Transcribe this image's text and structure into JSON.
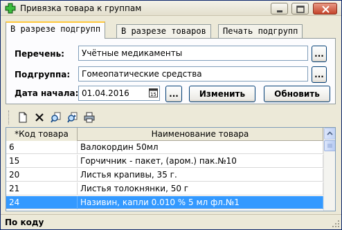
{
  "window": {
    "title": "Привязка товара к группам",
    "icon": "green-cross-icon"
  },
  "tabs": [
    {
      "label": "В разрезе подгрупп",
      "active": true
    },
    {
      "label": "В разрезе товаров",
      "active": false
    },
    {
      "label": "Печать подгрупп",
      "active": false
    }
  ],
  "form": {
    "list_label": "Перечень:",
    "list_value": "Учётные медикаменты",
    "subgroup_label": "Подгруппа:",
    "subgroup_value": "Гомеопатические средства",
    "start_date_label": "Дата начала:",
    "start_date_value": "01.04.2016",
    "browse_label": "...",
    "change_button": "Изменить",
    "refresh_button": "Обновить"
  },
  "toolbar": {
    "icons": [
      "new-document-icon",
      "delete-icon",
      "find-icon",
      "find-next-icon",
      "print-icon"
    ]
  },
  "grid": {
    "columns": [
      "*Код товара",
      "Наименование товара"
    ],
    "rows": [
      {
        "code": "6",
        "name": "Валокордин 50мл"
      },
      {
        "code": "15",
        "name": "Горчичник - пакет, (аром.) пак.№10"
      },
      {
        "code": "20",
        "name": "Листья крапивы,  35 г."
      },
      {
        "code": "21",
        "name": "Листья толокнянки, 50 г"
      },
      {
        "code": "24",
        "name": "Називин, капли 0.010 % 5 мл фл.№1"
      }
    ],
    "selected_index": 4
  },
  "status": {
    "text": "По коду"
  },
  "colors": {
    "selection": "#3399ff",
    "tab_highlight": "#ffc83c"
  }
}
